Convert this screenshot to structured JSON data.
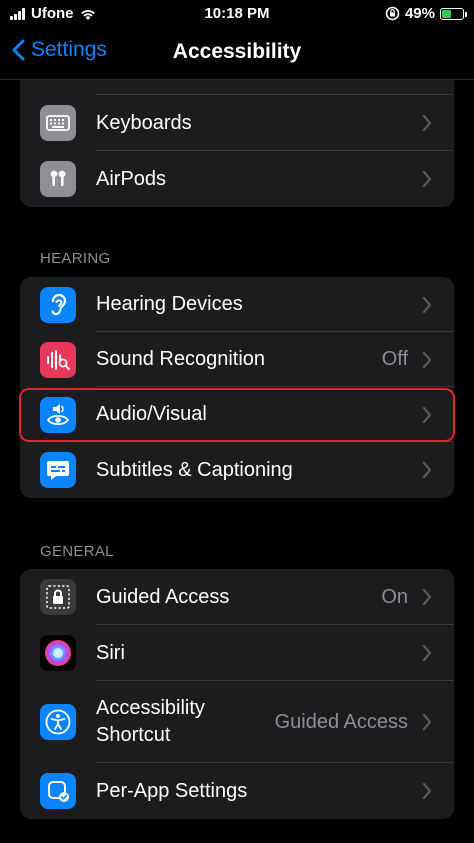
{
  "status": {
    "carrier": "Ufone",
    "time": "10:18 PM",
    "battery": "49%",
    "battery_level": 0.49
  },
  "nav": {
    "back_label": "Settings",
    "title": "Accessibility"
  },
  "top_group": {
    "items": [
      {
        "label": "Keyboards"
      },
      {
        "label": "AirPods"
      }
    ]
  },
  "hearing": {
    "header": "HEARING",
    "items": [
      {
        "label": "Hearing Devices",
        "value": ""
      },
      {
        "label": "Sound Recognition",
        "value": "Off"
      },
      {
        "label": "Audio/Visual",
        "value": ""
      },
      {
        "label": "Subtitles & Captioning",
        "value": ""
      }
    ]
  },
  "general": {
    "header": "GENERAL",
    "items": [
      {
        "label": "Guided Access",
        "value": "On"
      },
      {
        "label": "Siri",
        "value": ""
      },
      {
        "label_line1": "Accessibility",
        "label_line2": "Shortcut",
        "value": "Guided Access"
      },
      {
        "label": "Per-App Settings",
        "value": ""
      }
    ]
  },
  "colors": {
    "accent": "#0a84ff",
    "highlight": "#e8232c",
    "cell_bg": "#1c1c1e"
  }
}
